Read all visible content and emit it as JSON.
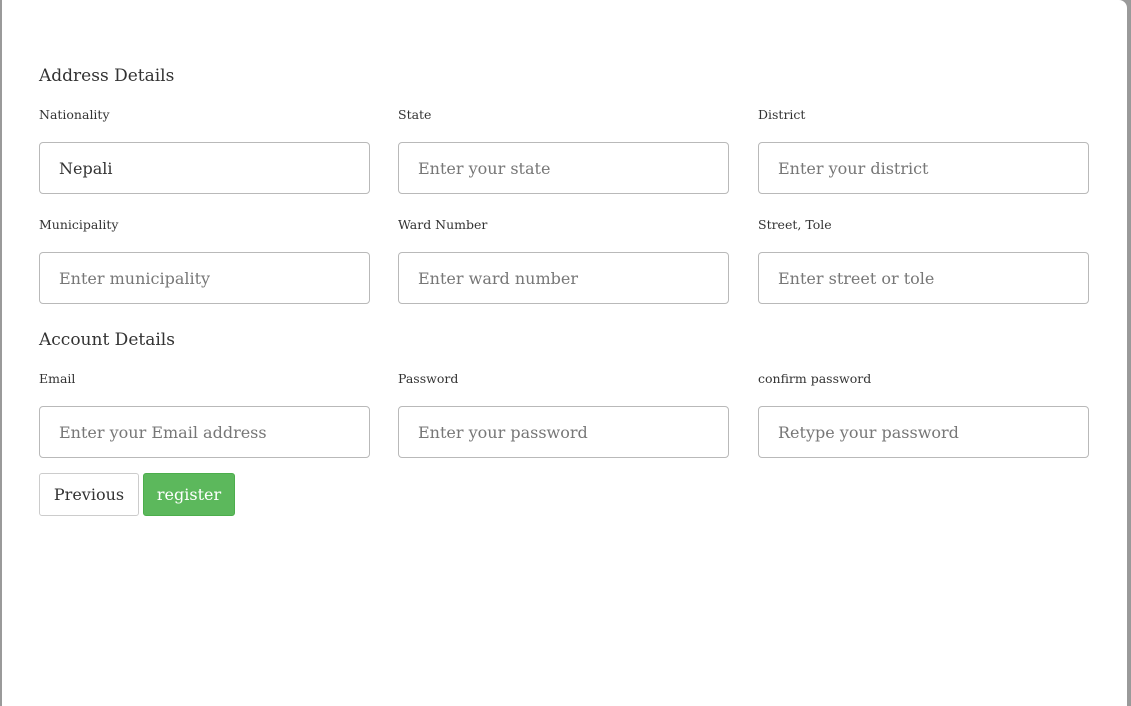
{
  "address": {
    "title": "Address Details",
    "nationality": {
      "label": "Nationality",
      "value": "Nepali"
    },
    "state": {
      "label": "State",
      "placeholder": "Enter your state"
    },
    "district": {
      "label": "District",
      "placeholder": "Enter your district"
    },
    "municipality": {
      "label": "Municipality",
      "placeholder": "Enter municipality"
    },
    "ward": {
      "label": "Ward Number",
      "placeholder": "Enter ward number"
    },
    "street": {
      "label": "Street, Tole",
      "placeholder": "Enter street or tole"
    }
  },
  "account": {
    "title": "Account Details",
    "email": {
      "label": "Email",
      "placeholder": "Enter your Email address"
    },
    "password": {
      "label": "Password",
      "placeholder": "Enter your password"
    },
    "confirm": {
      "label": "confirm password",
      "placeholder": "Retype your password"
    }
  },
  "buttons": {
    "previous": "Previous",
    "register": "register"
  },
  "colors": {
    "register_bg": "#5cb85c",
    "input_border": "#b9b9b9"
  }
}
